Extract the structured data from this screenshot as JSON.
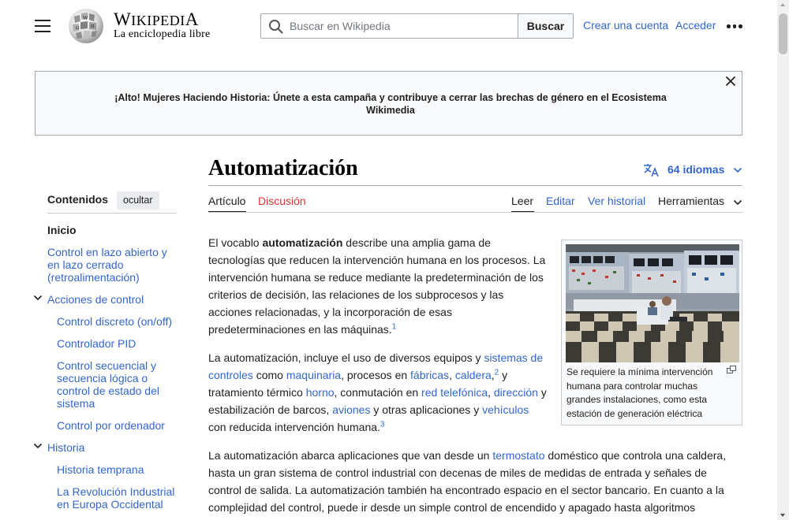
{
  "header": {
    "logo_word_first": "W",
    "logo_word_rest": "IKIPEDI",
    "logo_word_last": "A",
    "logo_tagline": "La enciclopedia libre",
    "search_placeholder": "Buscar en Wikipedia",
    "search_button": "Buscar",
    "create_account": "Crear una cuenta",
    "login": "Acceder"
  },
  "banner": {
    "text": "¡Alto! Mujeres Haciendo Historia: Únete a esta campaña y contribuye a cerrar las brechas de género en el Ecosistema Wikimedia"
  },
  "toc": {
    "title": "Contenidos",
    "hide_button": "ocultar",
    "items": [
      {
        "label": "Inicio"
      },
      {
        "label": "Control en lazo abierto y en lazo cerrado (retroalimentación)"
      },
      {
        "label": "Acciones de control"
      },
      {
        "label": "Control discreto (on/off)"
      },
      {
        "label": "Controlador PID"
      },
      {
        "label": "Control secuencial y secuencia lógica o control de estado del sistema"
      },
      {
        "label": "Control por ordenador"
      },
      {
        "label": "Historia"
      },
      {
        "label": "Historia temprana"
      },
      {
        "label": "La Revolución Industrial en Europa Occidental"
      }
    ]
  },
  "article": {
    "title": "Automatización",
    "languages": "64 idiomas",
    "tabs_left": [
      "Artículo",
      "Discusión"
    ],
    "tabs_right": [
      "Leer",
      "Editar",
      "Ver historial",
      "Herramientas"
    ],
    "p1": {
      "pre": "El vocablo ",
      "bold": "automatización",
      "post": " describe una amplia gama de tecnologías que reducen la intervención humana en los procesos. La intervención humana se reduce mediante la predeterminación de los criterios de decisión, las relaciones de los subprocesos y las acciones relacionadas, y la incorporación de esas predeterminaciones en las máquinas.",
      "ref": "1"
    },
    "p2": {
      "t1": "La automatización, incluye el uso de diversos equipos y ",
      "l1": "sistemas de controles",
      "t2": " como ",
      "l2": "maquinaria",
      "t3": ", procesos en ",
      "l3": "fábricas",
      "t4": ", ",
      "l4": "caldera",
      "t5": ",",
      "ref2": "2",
      "t6": "  y tratamiento térmico ",
      "l5": "horno",
      "t7": ", conmutación en ",
      "l6": "red telefónica",
      "t8": ", ",
      "l7": "dirección",
      "t9": " y estabilización de barcos, ",
      "l8": "aviones",
      "t10": " y otras aplicaciones y ",
      "l9": "vehículos",
      "t11": " con reducida intervención humana.",
      "ref3": "3"
    },
    "p3": {
      "t1": "La automatización abarca aplicaciones que van desde un ",
      "l1": "termostato",
      "t2": " doméstico que controla una caldera, hasta un gran sistema de control industrial con decenas de miles de medidas de entrada y señales de control de salida. La automatización también ha encontrado espacio en el sector bancario. En cuanto a la complejidad del control, puede ir desde un simple control de encendido y apagado hasta algoritmos"
    },
    "image_caption": "Se requiere la mínima intervención humana para controlar muchas grandes instalaciones, como esta estación de generación eléctrica"
  }
}
